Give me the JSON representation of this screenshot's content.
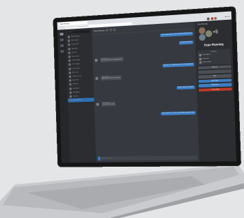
{
  "browser": {
    "tab_title": "Expo Planning",
    "url": "app.example.com/chat/expo-planning",
    "user_menu": "Johanna"
  },
  "sidebar": {
    "search_placeholder": "Search",
    "chats": [
      {
        "name": "Expo Planning"
      },
      {
        "name": "Maria Lopez"
      },
      {
        "name": "Design Team"
      },
      {
        "name": "Aaron Bell"
      },
      {
        "name": "Kim Cho"
      },
      {
        "name": "Sales Leads"
      },
      {
        "name": "Omar Haddad"
      },
      {
        "name": "Tech Support"
      },
      {
        "name": "Lena Fischer"
      },
      {
        "name": "Ben Carter"
      },
      {
        "name": "Product Launch"
      },
      {
        "name": "Nina Patel"
      },
      {
        "name": "Marketing"
      },
      {
        "name": "Sam Reed"
      },
      {
        "name": "HR Updates"
      },
      {
        "name": "Logistics"
      },
      {
        "name": "Expo Planning"
      }
    ]
  },
  "chat": {
    "title": "Expo Planning",
    "composer_placeholder": "Type a message...",
    "messages": [
      {
        "text": "Great, booth layout is final. Sending the files now",
        "sender": ""
      },
      {
        "text": "I'll check the booth",
        "sender": ""
      },
      {
        "text": "Can you confirm the shipping date?",
        "sender": "Harvey Adams"
      },
      {
        "text": "Banners are ready for print, just need approval",
        "sender": ""
      },
      {
        "text": "Approved! Send it to the printer",
        "sender": "Harvey Adams"
      },
      {
        "text": "Perfect, thanks everyone",
        "sender": ""
      },
      {
        "text": "See you at the expo",
        "sender": "Harvey Adams"
      },
      {
        "text": "Travel details are in the shared folder, see you there",
        "sender": ""
      }
    ]
  },
  "panel": {
    "back_label": "Expo Planning",
    "more_count": "+5",
    "title": "Expo Planning",
    "members_heading": "Members",
    "members": [
      {
        "name": "Harvey Adams"
      },
      {
        "name": "Kelly Jones"
      },
      {
        "name": "Johanna Smith"
      }
    ],
    "btn_more": "Show all",
    "btn_files": "Files",
    "btn_add": "Add People",
    "btn_mute": "Notifications",
    "btn_leave": "Leave Group"
  }
}
